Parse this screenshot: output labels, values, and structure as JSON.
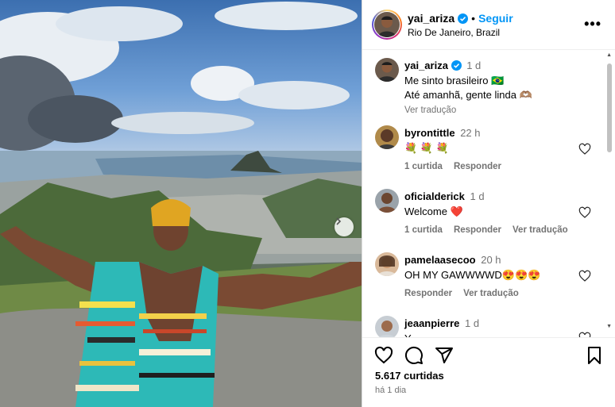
{
  "post": {
    "username": "yai_ariza",
    "separator": "•",
    "follow_label": "Seguir",
    "location": "Rio De Janeiro, Brazil",
    "more_label": "•••"
  },
  "caption": {
    "username": "yai_ariza",
    "time": "1 d",
    "line1": "Me sinto brasileiro 🇧🇷",
    "line2": "Até amanhã, gente linda 🫶🏽",
    "translate": "Ver tradução"
  },
  "comments": [
    {
      "username": "byrontittle",
      "time": "22 h",
      "text": "💐 💐 💐",
      "likes": "1 curtida",
      "reply": "Responder",
      "translate": ""
    },
    {
      "username": "oficialderick",
      "time": "1 d",
      "text": "Welcome ❤️",
      "likes": "1 curtida",
      "reply": "Responder",
      "translate": "Ver tradução"
    },
    {
      "username": "pamelaasecoo",
      "time": "20 h",
      "text": "OH MY GAWWWWD😍😍😍",
      "likes": "",
      "reply": "Responder",
      "translate": "Ver tradução"
    },
    {
      "username": "jeaanpierre",
      "time": "1 d",
      "text": "Y",
      "likes": "",
      "reply": "",
      "translate": ""
    }
  ],
  "footer": {
    "likes": "5.617 curtidas",
    "when": "há 1 dia"
  },
  "icons": {
    "like": "heart-icon",
    "comment": "comment-icon",
    "share": "share-icon",
    "save": "bookmark-icon",
    "verified": "verified-badge-icon",
    "next": "chevron-right-icon"
  },
  "colors": {
    "accent": "#0095f6",
    "verified": "#0095f6",
    "muted": "#737373",
    "heart": "#ed4956"
  }
}
